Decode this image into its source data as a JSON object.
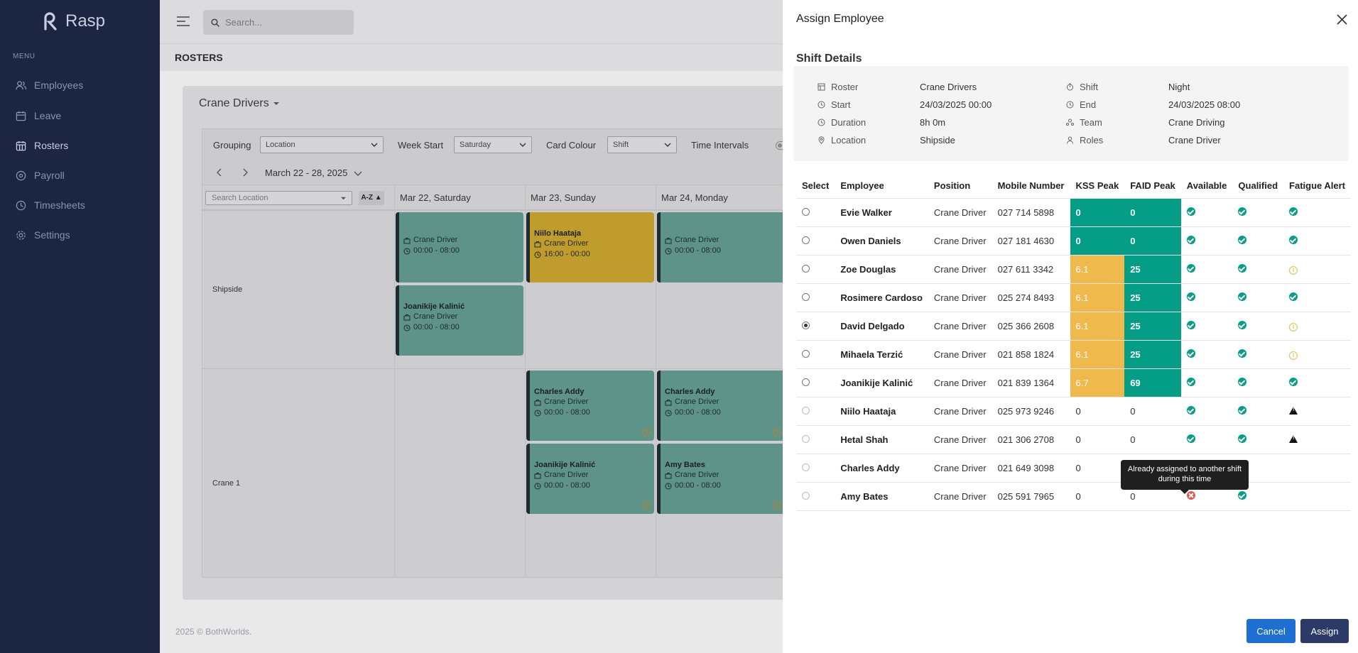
{
  "app": {
    "name": "Rasp"
  },
  "sidebar": {
    "menu_label": "MENU",
    "items": [
      {
        "label": "Employees",
        "icon": "users-icon"
      },
      {
        "label": "Leave",
        "icon": "calendar-icon"
      },
      {
        "label": "Rosters",
        "icon": "roster-icon",
        "active": true
      },
      {
        "label": "Payroll",
        "icon": "payroll-icon"
      },
      {
        "label": "Timesheets",
        "icon": "clock-icon"
      },
      {
        "label": "Settings",
        "icon": "gear-icon"
      }
    ]
  },
  "topbar": {
    "search_placeholder": "Search..."
  },
  "page": {
    "title": "ROSTERS",
    "footer": "2025 © BothWorlds."
  },
  "roster": {
    "name": "Crane Drivers",
    "filters": {
      "grouping_label": "Grouping",
      "grouping_value": "Location",
      "week_start_label": "Week Start",
      "week_start_value": "Saturday",
      "card_colour_label": "Card Colour",
      "card_colour_value": "Shift",
      "time_intervals_label": "Time Intervals"
    },
    "date_range": "March 22 - 28, 2025",
    "location_search_placeholder": "Search Location",
    "sort_label": "A-Z ▲",
    "columns": [
      "Mar 22, Saturday",
      "Mar 23, Sunday",
      "Mar 24, Monday"
    ],
    "rows": [
      "Shipside",
      "Crane 1"
    ],
    "shifts": [
      {
        "name": "",
        "role": "Crane Driver",
        "time": "00:00 - 08:00"
      },
      {
        "name": "Joanikije Kalinić",
        "role": "Crane Driver",
        "time": "00:00 - 08:00"
      },
      {
        "name": "Niilo Haataja",
        "role": "Crane Driver",
        "time": "16:00 - 00:00"
      },
      {
        "name": "",
        "role": "Crane Driver",
        "time": "00:00 - 08:00"
      },
      {
        "name": "Charles Addy",
        "role": "Crane Driver",
        "time": "00:00 - 08:00"
      },
      {
        "name": "Charles Addy",
        "role": "Crane Driver",
        "time": "00:00 - 08:00"
      },
      {
        "name": "Joanikije Kalinić",
        "role": "Crane Driver",
        "time": "00:00 - 08:00"
      },
      {
        "name": "Amy Bates",
        "role": "Crane Driver",
        "time": "00:00 - 08:00"
      }
    ]
  },
  "drawer": {
    "title": "Assign Employee",
    "shift_details_title": "Shift Details",
    "details": {
      "roster_label": "Roster",
      "roster": "Crane Drivers",
      "shift_label": "Shift",
      "shift": "Night",
      "start_label": "Start",
      "start": "24/03/2025 00:00",
      "end_label": "End",
      "end": "24/03/2025 08:00",
      "duration_label": "Duration",
      "duration": "8h 0m",
      "team_label": "Team",
      "team": "Crane Driving",
      "location_label": "Location",
      "location": "Shipside",
      "roles_label": "Roles",
      "roles": "Crane Driver"
    },
    "table_headers": [
      "Select",
      "Employee",
      "Position",
      "Mobile Number",
      "KSS Peak",
      "FAID Peak",
      "Available",
      "Qualified",
      "Fatigue Alert"
    ],
    "employees": [
      {
        "name": "Evie Walker",
        "position": "Crane Driver",
        "mobile": "027 714 5898",
        "kss": "0",
        "faid": "0",
        "available": "check",
        "qualified": "check",
        "fatigue": "check",
        "kss_color": "green",
        "faid_color": "green"
      },
      {
        "name": "Owen Daniels",
        "position": "Crane Driver",
        "mobile": "027 181 4630",
        "kss": "0",
        "faid": "0",
        "available": "check",
        "qualified": "check",
        "fatigue": "check",
        "kss_color": "green",
        "faid_color": "green"
      },
      {
        "name": "Zoe Douglas",
        "position": "Crane Driver",
        "mobile": "027 611 3342",
        "kss": "6.1",
        "faid": "25",
        "available": "check",
        "qualified": "check",
        "fatigue": "info",
        "kss_color": "orange",
        "faid_color": "green"
      },
      {
        "name": "Rosimere Cardoso",
        "position": "Crane Driver",
        "mobile": "025 274 8493",
        "kss": "6.1",
        "faid": "25",
        "available": "check",
        "qualified": "check",
        "fatigue": "check",
        "kss_color": "orange",
        "faid_color": "green"
      },
      {
        "name": "David Delgado",
        "position": "Crane Driver",
        "mobile": "025 366 2608",
        "kss": "6.1",
        "faid": "25",
        "available": "check",
        "qualified": "check",
        "fatigue": "info",
        "kss_color": "orange",
        "faid_color": "green",
        "selected": true
      },
      {
        "name": "Mihaela Terzić",
        "position": "Crane Driver",
        "mobile": "021 858 1824",
        "kss": "6.1",
        "faid": "25",
        "available": "check",
        "qualified": "check",
        "fatigue": "info",
        "kss_color": "orange",
        "faid_color": "green"
      },
      {
        "name": "Joanikije Kalinić",
        "position": "Crane Driver",
        "mobile": "021 839 1364",
        "kss": "6.7",
        "faid": "69",
        "available": "check",
        "qualified": "check",
        "fatigue": "check",
        "kss_color": "orange",
        "faid_color": "green"
      },
      {
        "name": "Niilo Haataja",
        "position": "Crane Driver",
        "mobile": "025 973 9246",
        "kss": "0",
        "faid": "0",
        "available": "check",
        "qualified": "check",
        "fatigue": "warning",
        "disabled": true
      },
      {
        "name": "Hetal Shah",
        "position": "Crane Driver",
        "mobile": "021 306 2708",
        "kss": "0",
        "faid": "0",
        "available": "check",
        "qualified": "check",
        "fatigue": "warning",
        "disabled": true
      },
      {
        "name": "Charles Addy",
        "position": "Crane Driver",
        "mobile": "021 649 3098",
        "kss": "0",
        "faid": "",
        "available": "",
        "qualified": "",
        "fatigue": "",
        "disabled": true
      },
      {
        "name": "Amy Bates",
        "position": "Crane Driver",
        "mobile": "025 591 7965",
        "kss": "0",
        "faid": "0",
        "available": "cross",
        "qualified": "check",
        "fatigue": "",
        "disabled": true
      }
    ],
    "tooltip": "Already assigned to another shift during this time",
    "cancel_label": "Cancel",
    "assign_label": "Assign"
  },
  "colors": {
    "sidebar": "#1c2541",
    "green": "#049e86",
    "orange": "#f0b94c",
    "primary": "#1d6fd1",
    "assign": "#2b3a67"
  }
}
